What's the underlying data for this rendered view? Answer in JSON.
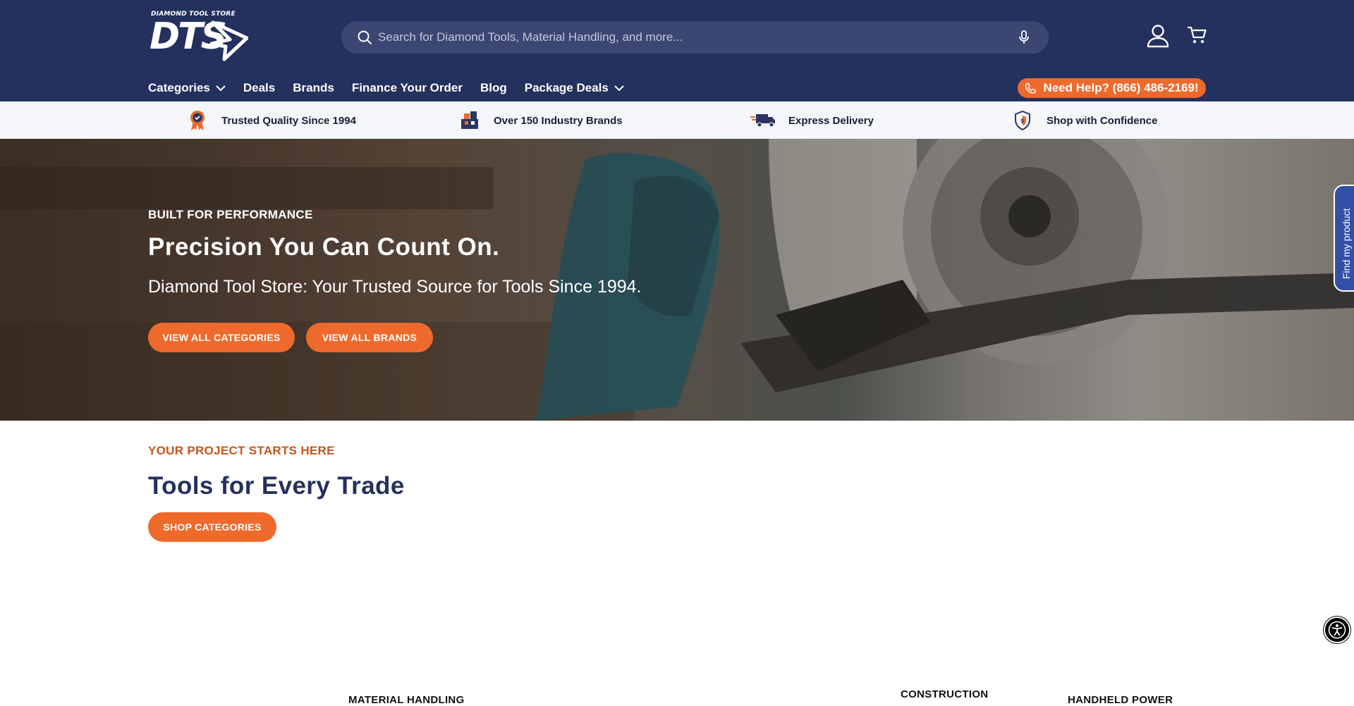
{
  "header": {
    "logo": {
      "small_text": "DIAMOND TOOL STORE",
      "main_text": "DTS"
    },
    "search": {
      "placeholder": "Search for Diamond Tools, Material Handling, and more..."
    },
    "nav": [
      {
        "label": "Categories",
        "has_dropdown": true
      },
      {
        "label": "Deals",
        "has_dropdown": false
      },
      {
        "label": "Brands",
        "has_dropdown": false
      },
      {
        "label": "Finance Your Order",
        "has_dropdown": false
      },
      {
        "label": "Blog",
        "has_dropdown": false
      },
      {
        "label": "Package Deals",
        "has_dropdown": true
      }
    ],
    "help_label": "Need Help? (866) 486-2169!"
  },
  "trust_bar": [
    {
      "label": "Trusted Quality Since 1994",
      "icon": "award-ribbon-icon"
    },
    {
      "label": "Over 150 Industry Brands",
      "icon": "boxes-icon"
    },
    {
      "label": "Express Delivery",
      "icon": "delivery-truck-icon"
    },
    {
      "label": "Shop with Confidence",
      "icon": "shield-icon"
    }
  ],
  "hero": {
    "kicker": "BUILT FOR PERFORMANCE",
    "title": "Precision You Can Count On.",
    "subtitle": "Diamond Tool Store: Your Trusted Source for Tools Since 1994.",
    "buttons": [
      "VIEW ALL CATEGORIES",
      "VIEW ALL BRANDS"
    ]
  },
  "side_tab": {
    "label": "Find my product"
  },
  "section": {
    "kicker": "YOUR PROJECT STARTS HERE",
    "title": "Tools for Every Trade",
    "button": "SHOP CATEGORIES",
    "category_labels": [
      "MATERIAL HANDLING",
      "CONSTRUCTION",
      "HANDHELD POWER"
    ]
  },
  "colors": {
    "navy": "#24305e",
    "orange": "#ee6a2c",
    "kicker_orange": "#c4551d",
    "side_tab_blue": "#3150a8"
  }
}
